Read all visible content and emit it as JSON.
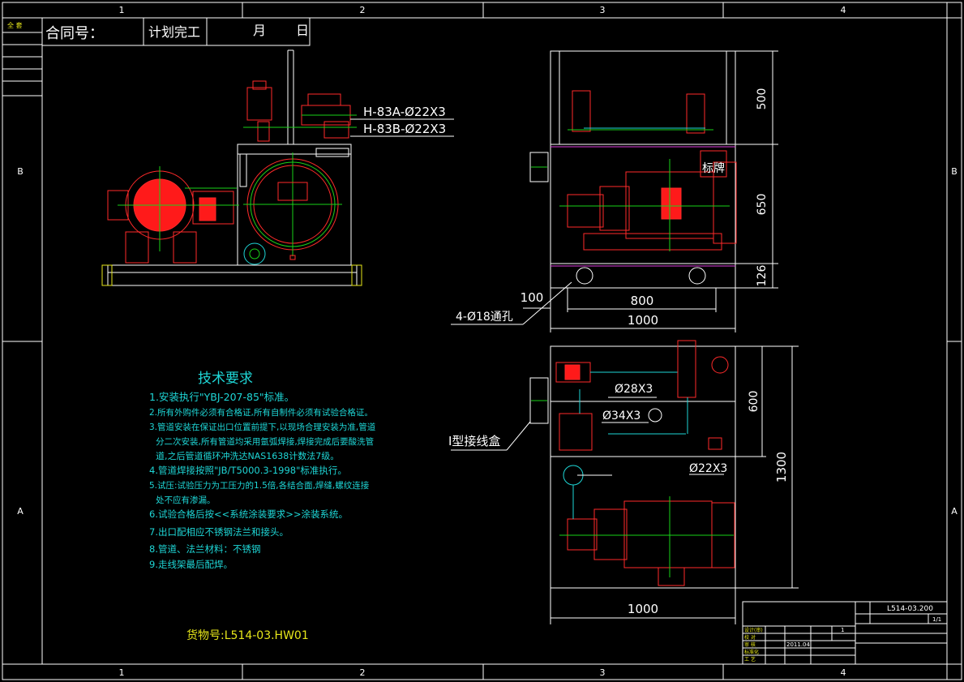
{
  "frame": {
    "col_labels": [
      "1",
      "2",
      "3",
      "4"
    ],
    "row_labels": [
      "B",
      "A"
    ]
  },
  "header": {
    "corner": "全  套",
    "contract_label": "合同号：",
    "plan_label": "计划完工",
    "month_label": "月",
    "day_label": "日"
  },
  "callouts": {
    "pipe_a": "H-83A-Ø22X3",
    "pipe_b": "H-83B-Ø22X3"
  },
  "front_view": {
    "nameplate": "标牌",
    "dim_500": "500",
    "dim_650": "650",
    "dim_126": "126",
    "dim_100": "100",
    "dim_800": "800",
    "dim_1000": "1000",
    "holes": "4-Ø18通孔"
  },
  "top_view": {
    "pipe_28": "Ø28X3",
    "pipe_34": "Ø34X3",
    "pipe_22": "Ø22X3",
    "junction_box": "I型接线盒",
    "dim_600": "600",
    "dim_1300": "1300",
    "dim_1000": "1000"
  },
  "requirements": {
    "title": "技术要求",
    "items": [
      "1.安装执行\"YBJ-207-85\"标准。",
      "2.所有外购件必须有合格证,所有自制件必须有试验合格证。",
      "3.管道安装在保证出口位置前提下,以现场合理安装为准,管道",
      "分二次安装,所有管道均采用氩弧焊接,焊接完成后要酸洗管",
      "道,之后管道循环冲洗达NAS1638计数法7级。",
      "4.管道焊接按照\"JB/T5000.3-1998\"标准执行。",
      "5.试压:试验压力为工压力的1.5倍,各结合面,焊缝,螺纹连接",
      "处不应有渗漏。",
      "6.试验合格后按<<系统涂装要求>>涂装系统。",
      "7.出口配相应不锈钢法兰和接头。",
      "8.管道、法兰材料：不锈钢",
      "9.走线架最后配焊。"
    ],
    "order_no": "货物号:L514-03.HW01"
  },
  "title_block": {
    "drawing_no": "L514-03.200",
    "sheet": "1/1",
    "count": "1",
    "date": "2011.04",
    "row_labels": [
      "设计(审)",
      "校 对",
      "审 核",
      "标准化",
      "工 艺",
      "批 准"
    ]
  }
}
